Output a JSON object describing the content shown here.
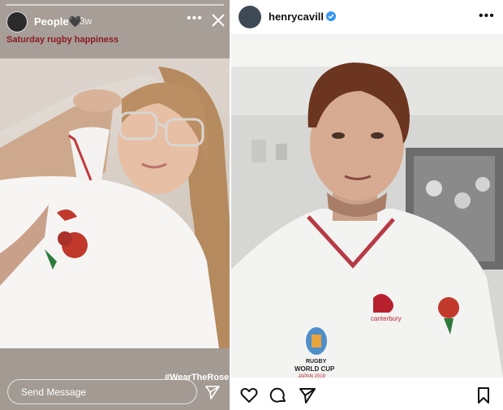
{
  "story": {
    "username": "People🖤",
    "time": "3w",
    "more_label": "•••",
    "caption": "Saturday rugby happiness",
    "hashtag": "#WearTheRose",
    "send_placeholder": "Send Message"
  },
  "post": {
    "username": "henrycavill",
    "more_label": "•••",
    "shirt_brand": "canterbury",
    "shirt_logo_text": [
      "RUGBY",
      "WORLD CUP",
      "JAPAN 2019"
    ]
  }
}
